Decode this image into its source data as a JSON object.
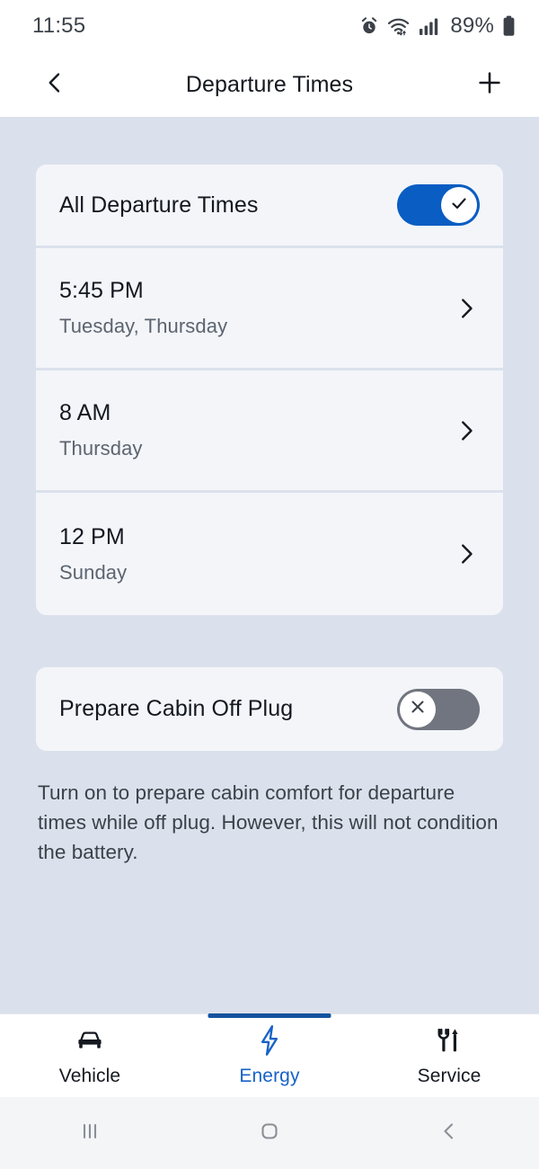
{
  "status_bar": {
    "time": "11:55",
    "battery_percent": "89%",
    "icons": [
      "alarm-icon",
      "wifi-icon",
      "cellular-signal-icon",
      "battery-icon"
    ]
  },
  "header": {
    "title": "Departure Times",
    "back_icon": "chevron-left-icon",
    "add_icon": "plus-icon"
  },
  "departure_card": {
    "all_row": {
      "label": "All Departure Times",
      "toggle_state": "on",
      "toggle_icon": "check-icon"
    },
    "items": [
      {
        "time": "5:45 PM",
        "days": "Tuesday, Thursday",
        "chevron": "chevron-right-icon"
      },
      {
        "time": "8 AM",
        "days": "Thursday",
        "chevron": "chevron-right-icon"
      },
      {
        "time": "12 PM",
        "days": "Sunday",
        "chevron": "chevron-right-icon"
      }
    ]
  },
  "cabin_card": {
    "label": "Prepare Cabin Off Plug",
    "toggle_state": "off",
    "toggle_icon": "close-icon"
  },
  "note": "Turn on to prepare cabin comfort for departure times while off plug. However, this will not condition the battery.",
  "tabs": [
    {
      "label": "Vehicle",
      "icon": "car-icon",
      "active": false
    },
    {
      "label": "Energy",
      "icon": "lightning-bolt-icon",
      "active": true
    },
    {
      "label": "Service",
      "icon": "wrench-screwdriver-icon",
      "active": false
    }
  ],
  "system_nav": {
    "recents": "recents-icon",
    "home": "home-icon",
    "back": "back-icon"
  },
  "colors": {
    "accent": "#1763c6",
    "toggle_on": "#0a5dc2",
    "toggle_off": "#71757f",
    "page_background": "#dbe1ec",
    "card_background": "#f3f5f9"
  }
}
